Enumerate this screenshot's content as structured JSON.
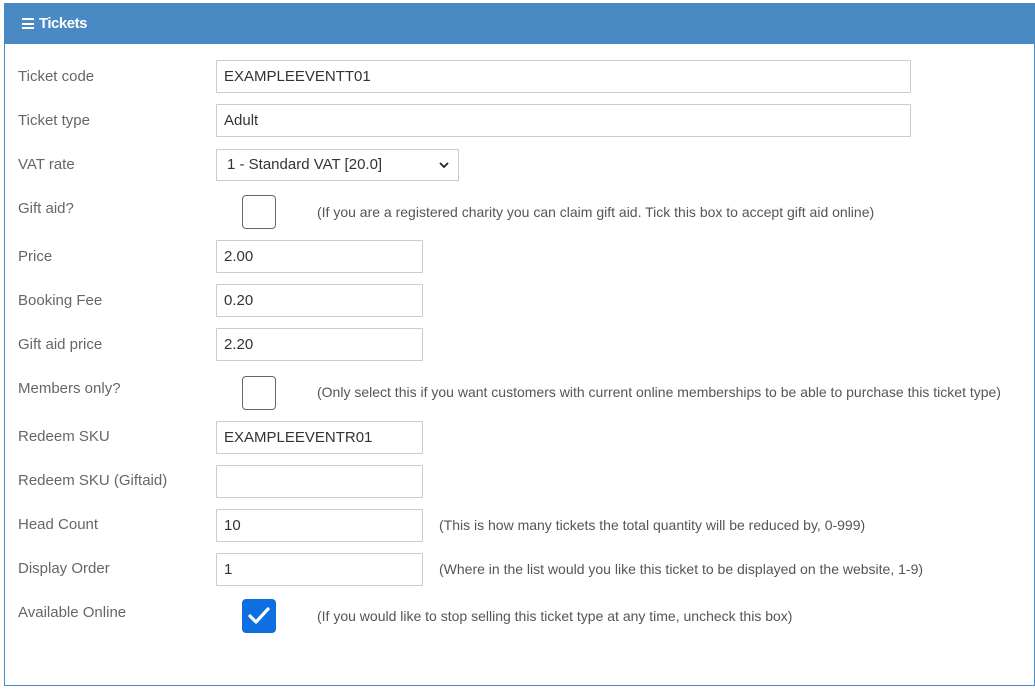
{
  "panel": {
    "title": "Tickets"
  },
  "form": {
    "ticket_code": {
      "label": "Ticket code",
      "value": "EXAMPLEEVENTT01"
    },
    "ticket_type": {
      "label": "Ticket type",
      "value": "Adult"
    },
    "vat_rate": {
      "label": "VAT rate",
      "value": "1 - Standard VAT [20.0]"
    },
    "gift_aid": {
      "label": "Gift aid?",
      "checked": false,
      "hint": "(If you are a registered charity you can claim gift aid. Tick this box to accept gift aid online)"
    },
    "price": {
      "label": "Price",
      "value": "2.00"
    },
    "booking_fee": {
      "label": "Booking Fee",
      "value": "0.20"
    },
    "gift_aid_price": {
      "label": "Gift aid price",
      "value": "2.20"
    },
    "members_only": {
      "label": "Members only?",
      "checked": false,
      "hint": "(Only select this if you want customers with current online memberships to be able to purchase this ticket type)"
    },
    "redeem_sku": {
      "label": "Redeem SKU",
      "value": "EXAMPLEEVENTR01"
    },
    "redeem_sku_giftaid": {
      "label": "Redeem SKU (Giftaid)",
      "value": ""
    },
    "head_count": {
      "label": "Head Count",
      "value": "10",
      "hint": "(This is how many tickets the total quantity will be reduced by, 0-999)"
    },
    "display_order": {
      "label": "Display Order",
      "value": "1",
      "hint": "(Where in the list would you like this ticket to be displayed on the website, 1-9)"
    },
    "available_online": {
      "label": "Available Online",
      "checked": true,
      "hint": "(If you would like to stop selling this ticket type at any time, uncheck this box)"
    }
  },
  "colors": {
    "header": "#4a8ac4",
    "checkbox_checked": "#0d6fe0"
  },
  "icons": {
    "header": "menu-icon",
    "select": "chevron-down-icon",
    "check": "checkmark-icon"
  }
}
